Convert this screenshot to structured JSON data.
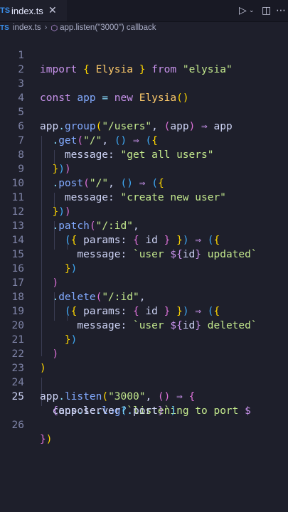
{
  "tab": {
    "badge": "TS",
    "filename": "index.ts"
  },
  "breadcrumb": {
    "badge": "TS",
    "file": "index.ts",
    "symbol": "app.listen(\"3000\") callback"
  },
  "code_lines": [
    {
      "n": "1",
      "text": "import { Elysia } from \"elysia\""
    },
    {
      "n": "2",
      "text": ""
    },
    {
      "n": "3",
      "text": "const app = new Elysia()"
    },
    {
      "n": "4",
      "text": ""
    },
    {
      "n": "5",
      "text": "app.group(\"/users\", (app) ⇒ app"
    },
    {
      "n": "6",
      "text": "  .get(\"/\", () ⇒ ({"
    },
    {
      "n": "7",
      "text": "    message: \"get all users\""
    },
    {
      "n": "8",
      "text": "  }))"
    },
    {
      "n": "9",
      "text": "  .post(\"/\", () ⇒ ({"
    },
    {
      "n": "10",
      "text": "    message: \"create new user\""
    },
    {
      "n": "11",
      "text": "  }))"
    },
    {
      "n": "12",
      "text": "  .patch(\"/:id\","
    },
    {
      "n": "13",
      "text": "    ({ params: { id } }) ⇒ ({"
    },
    {
      "n": "14",
      "text": "      message: `user ${id} updated`"
    },
    {
      "n": "15",
      "text": "    })"
    },
    {
      "n": "16",
      "text": "  )"
    },
    {
      "n": "17",
      "text": "  .delete(\"/:id\","
    },
    {
      "n": "18",
      "text": "    ({ params: { id } }) ⇒ ({"
    },
    {
      "n": "19",
      "text": "      message: `user ${id} deleted`"
    },
    {
      "n": "20",
      "text": "    })"
    },
    {
      "n": "21",
      "text": "  )"
    },
    {
      "n": "22",
      "text": ")"
    },
    {
      "n": "23",
      "text": ""
    },
    {
      "n": "24",
      "text": "app.listen(\"3000\", () ⇒ {"
    },
    {
      "n": "25",
      "text": "  console.log(`listening to port ${app.server?.port}`)"
    },
    {
      "n": "26",
      "text": "})"
    }
  ]
}
